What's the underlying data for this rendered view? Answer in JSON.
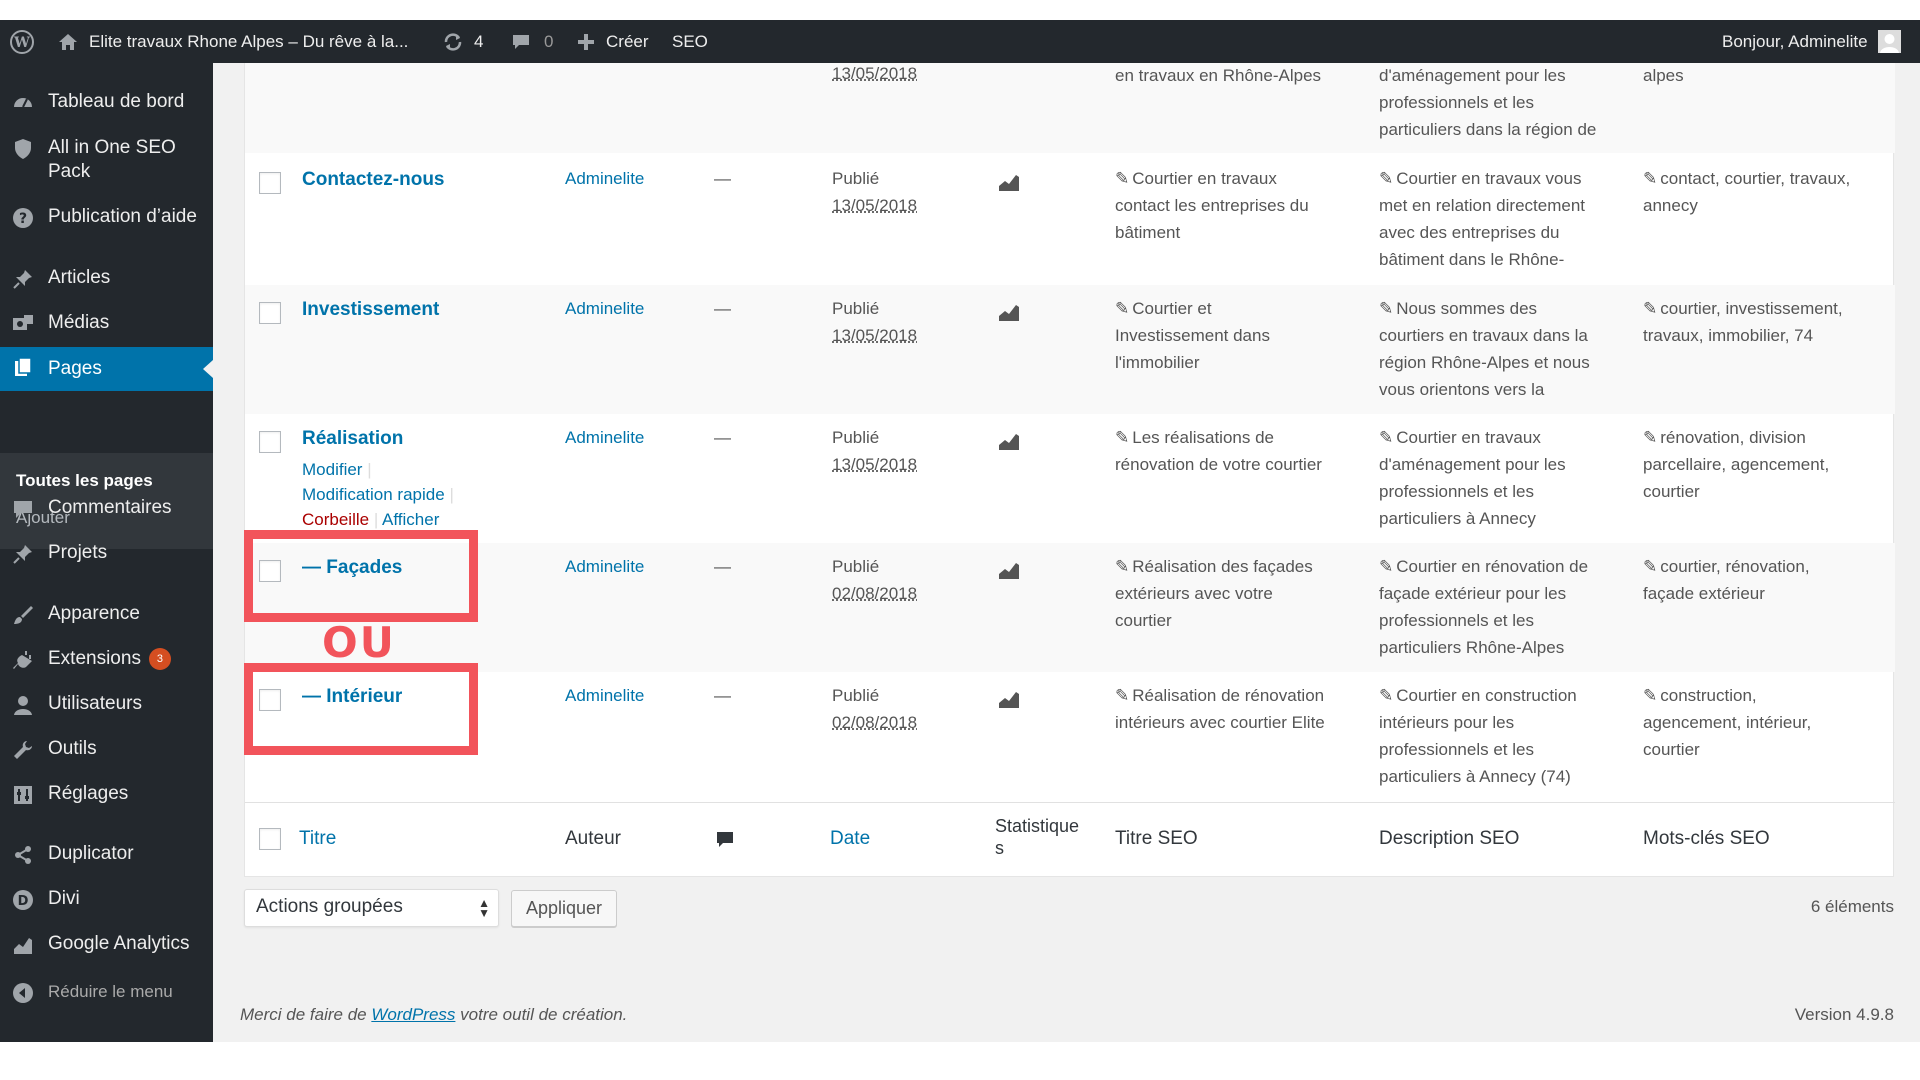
{
  "admin_bar": {
    "site_title": "Elite travaux Rhone Alpes – Du rêve à la...",
    "updates_count": "4",
    "comments_count": "0",
    "new_label": "Créer",
    "seo_label": "SEO",
    "greeting": "Bonjour, Adminelite"
  },
  "sidebar": {
    "items": {
      "dashboard": "Tableau de bord",
      "aioseo_line1": "All in One SEO",
      "aioseo_line2": "Pack",
      "help": "Publication d’aide",
      "articles": "Articles",
      "medias": "Médias",
      "pages": "Pages",
      "all_pages": "Toutes les pages",
      "add": "Ajouter",
      "comments": "Commentaires",
      "projects": "Projets",
      "appearance": "Apparence",
      "extensions": "Extensions",
      "extensions_badge": "3",
      "users": "Utilisateurs",
      "tools": "Outils",
      "settings": "Réglages",
      "duplicator": "Duplicator",
      "divi": "Divi",
      "analytics": "Google Analytics",
      "collapse": "Réduire le menu"
    }
  },
  "table": {
    "top_partial": {
      "date": "13/05/2018",
      "seo_title": "en travaux en Rhône-Alpes",
      "seo_desc_1": "d'aménagement pour les",
      "seo_desc_2": "professionnels et les",
      "seo_desc_3": "particuliers dans la région de",
      "keywords": "alpes"
    },
    "rows": [
      {
        "title": "Contactez-nous",
        "author": "Adminelite",
        "comments": "—",
        "status": "Publié",
        "date": "13/05/2018",
        "seo_title": [
          "Courtier en travaux",
          "contact les entreprises du",
          "bâtiment"
        ],
        "seo_desc": [
          "Courtier en travaux vous",
          "met en relation directement",
          "avec des entreprises du",
          "bâtiment dans le Rhône-"
        ],
        "keywords": [
          "contact, courtier, travaux,",
          "annecy"
        ]
      },
      {
        "title": "Investissement",
        "author": "Adminelite",
        "comments": "—",
        "status": "Publié",
        "date": "13/05/2018",
        "seo_title": [
          "Courtier et",
          "Investissement dans",
          "l'immobilier"
        ],
        "seo_desc": [
          "Nous sommes des",
          "courtiers en travaux dans la",
          "région Rhône-Alpes et nous",
          "vous orientons vers la"
        ],
        "keywords": [
          "courtier, investissement,",
          "travaux, immobilier, 74"
        ]
      },
      {
        "title": "Réalisation",
        "author": "Adminelite",
        "comments": "—",
        "status": "Publié",
        "date": "13/05/2018",
        "seo_title": [
          "Les réalisations de",
          "rénovation de votre courtier"
        ],
        "seo_desc": [
          "Courtier en travaux",
          "d'aménagement pour les",
          "professionnels et les",
          "particuliers à Annecy"
        ],
        "keywords": [
          "rénovation, division",
          "parcellaire, agencement,",
          "courtier"
        ],
        "actions": {
          "edit": "Modifier",
          "quick_edit": "Modification rapide",
          "trash": "Corbeille",
          "view": "Afficher"
        }
      },
      {
        "title": "— Façades",
        "author": "Adminelite",
        "comments": "—",
        "status": "Publié",
        "date": "02/08/2018",
        "seo_title": [
          "Réalisation des façades",
          "extérieurs avec votre",
          "courtier"
        ],
        "seo_desc": [
          "Courtier en rénovation de",
          "façade extérieur pour les",
          "professionnels et les",
          "particuliers Rhône-Alpes"
        ],
        "keywords": [
          "courtier, rénovation,",
          "façade extérieur"
        ]
      },
      {
        "title": "— Intérieur",
        "author": "Adminelite",
        "comments": "—",
        "status": "Publié",
        "date": "02/08/2018",
        "seo_title": [
          "Réalisation de rénovation",
          "intérieurs avec courtier Elite"
        ],
        "seo_desc": [
          "Courtier en construction",
          "intérieurs pour les",
          "professionnels et les",
          "particuliers à Annecy (74)"
        ],
        "keywords": [
          "construction,",
          "agencement, intérieur,",
          "courtier"
        ]
      }
    ],
    "footer_headers": {
      "title": "Titre",
      "author": "Auteur",
      "date": "Date",
      "stats_1": "Statistique",
      "stats_2": "s",
      "seo_title": "Titre SEO",
      "seo_desc": "Description SEO",
      "seo_keywords": "Mots-clés SEO"
    }
  },
  "bulk": {
    "select_value": "Actions groupées",
    "apply": "Appliquer",
    "count": "6 éléments"
  },
  "footer": {
    "thanks_pre": "Merci de faire de ",
    "thanks_link": "WordPress",
    "thanks_post": " votre outil de création.",
    "version": "Version 4.9.8"
  },
  "annotation": {
    "or_text": "OU",
    "color": "#f2545b"
  }
}
